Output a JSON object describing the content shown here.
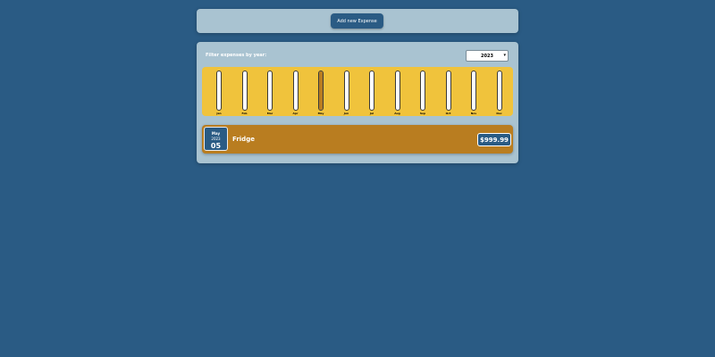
{
  "new_expense": {
    "add_button_label": "Add new Expense"
  },
  "filter": {
    "label": "Filter expenses by year:",
    "selected_year": "2023"
  },
  "chart_data": {
    "type": "bar",
    "categories": [
      "Jan",
      "Feb",
      "Mar",
      "Apr",
      "May",
      "Jun",
      "Jul",
      "Aug",
      "Sep",
      "Oct",
      "Nov",
      "Dec"
    ],
    "values": [
      0,
      0,
      0,
      0,
      999.99,
      0,
      0,
      0,
      0,
      0,
      0,
      0
    ],
    "ylim": [
      0,
      999.99
    ],
    "colors": {
      "track": "#ffffff",
      "fill": "#b97d20",
      "background": "#f0c33c"
    }
  },
  "expenses": [
    {
      "month": "May",
      "year": "2023",
      "day": "05",
      "title": "Fridge",
      "amount": "$999.99"
    }
  ]
}
